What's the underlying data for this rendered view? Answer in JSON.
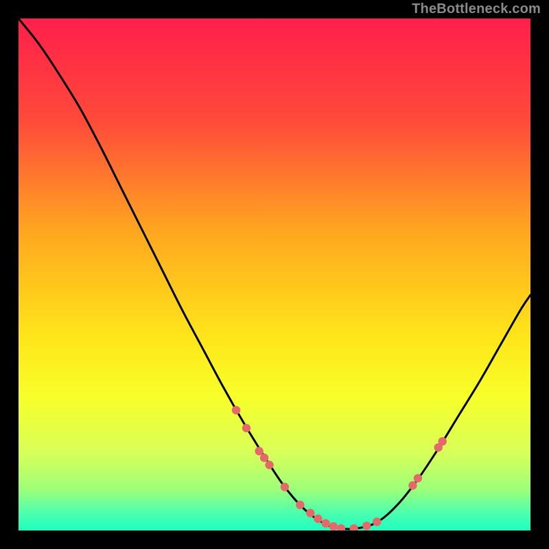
{
  "watermark": "TheBottleneck.com",
  "chart_data": {
    "type": "line",
    "title": "",
    "xlabel": "",
    "ylabel": "",
    "xlim": [
      0,
      100
    ],
    "ylim": [
      0,
      100
    ],
    "series": [
      {
        "name": "bottleneck-curve",
        "x": [
          0,
          4,
          8,
          12,
          16,
          20,
          24,
          28,
          32,
          36,
          40,
          44,
          48,
          52,
          56,
          60,
          63,
          66,
          70,
          74,
          78,
          82,
          86,
          90,
          94,
          98,
          100
        ],
        "y": [
          100,
          95,
          89,
          82.5,
          75,
          67,
          59,
          51,
          43,
          35.5,
          28,
          21,
          14.5,
          8.5,
          4,
          1.2,
          0.4,
          0.4,
          1.6,
          5,
          10,
          16,
          22.5,
          29,
          36,
          43,
          46
        ]
      }
    ],
    "markers": {
      "name": "highlight-points",
      "color": "#e46a6a",
      "x": [
        42.5,
        44.5,
        47,
        48,
        49,
        52,
        55,
        57,
        58.5,
        60,
        61.5,
        63,
        65.5,
        68,
        70,
        77,
        78,
        82,
        82.8
      ],
      "y": [
        23.5,
        20,
        15.5,
        14.2,
        12.8,
        8.5,
        5,
        3.4,
        2.3,
        1.4,
        0.8,
        0.4,
        0.4,
        0.9,
        1.7,
        8.8,
        10.2,
        16.2,
        17.4
      ]
    },
    "gradient_stops": [
      {
        "offset": 0,
        "color": "#ff1f4b"
      },
      {
        "offset": 0.2,
        "color": "#ff4a3a"
      },
      {
        "offset": 0.42,
        "color": "#ffa81f"
      },
      {
        "offset": 0.62,
        "color": "#ffe51a"
      },
      {
        "offset": 0.74,
        "color": "#f7ff2a"
      },
      {
        "offset": 0.85,
        "color": "#d7ff59"
      },
      {
        "offset": 0.92,
        "color": "#9dff7a"
      },
      {
        "offset": 0.965,
        "color": "#4dffad"
      },
      {
        "offset": 1.0,
        "color": "#1effc0"
      }
    ]
  }
}
